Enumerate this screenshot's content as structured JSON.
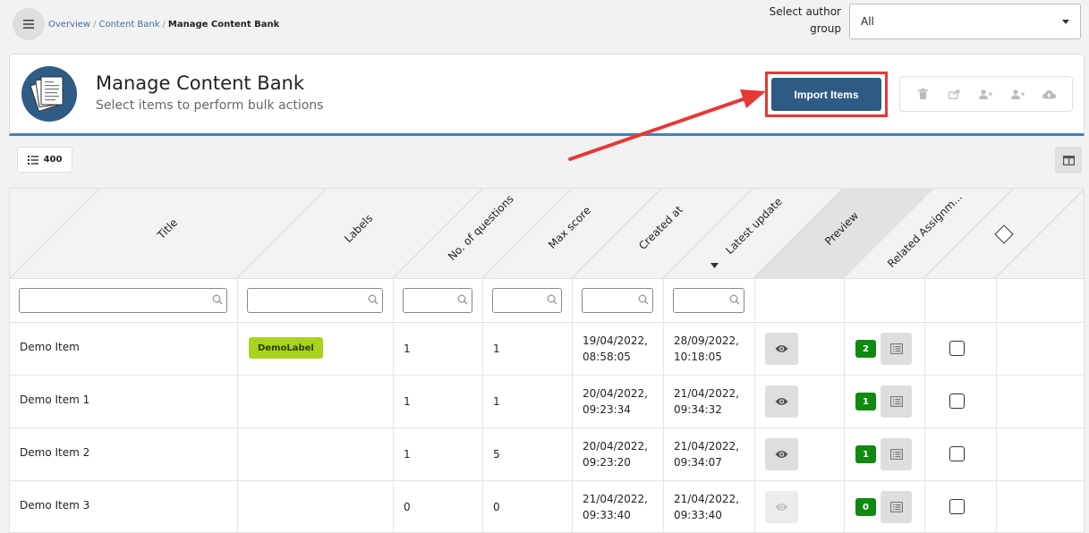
{
  "breadcrumb": {
    "items": [
      "Overview",
      "Content Bank"
    ],
    "separator": "/",
    "current": "Manage Content Bank"
  },
  "author_group": {
    "label": "Select author group",
    "value": "All"
  },
  "header": {
    "title": "Manage Content Bank",
    "subtitle": "Select items to perform bulk actions",
    "import_label": "Import Items",
    "actions": [
      "trash-icon",
      "share-icon",
      "add-user-icon",
      "add-user-icon",
      "cloud-upload-icon"
    ]
  },
  "toolbar": {
    "count": "400"
  },
  "table": {
    "columns": [
      "Title",
      "Labels",
      "No. of questions",
      "Max score",
      "Created at",
      "Latest update",
      "Preview",
      "Related Assignm..."
    ],
    "sorted_column": "Latest update",
    "rows": [
      {
        "title": "Demo Item",
        "label": "DemoLabel",
        "questions": "1",
        "max_score": "1",
        "created_date": "19/04/2022,",
        "created_time": "08:58:05",
        "updated_date": "28/09/2022,",
        "updated_time": "10:18:05",
        "preview_enabled": true,
        "assignments": "2"
      },
      {
        "title": "Demo Item 1",
        "label": "",
        "questions": "1",
        "max_score": "1",
        "created_date": "20/04/2022,",
        "created_time": "09:23:34",
        "updated_date": "21/04/2022,",
        "updated_time": "09:34:32",
        "preview_enabled": true,
        "assignments": "1"
      },
      {
        "title": "Demo Item 2",
        "label": "",
        "questions": "1",
        "max_score": "5",
        "created_date": "20/04/2022,",
        "created_time": "09:23:20",
        "updated_date": "21/04/2022,",
        "updated_time": "09:34:07",
        "preview_enabled": true,
        "assignments": "1"
      },
      {
        "title": "Demo Item 3",
        "label": "",
        "questions": "0",
        "max_score": "0",
        "created_date": "21/04/2022,",
        "created_time": "09:33:40",
        "updated_date": "21/04/2022,",
        "updated_time": "09:33:40",
        "preview_enabled": false,
        "assignments": "0"
      }
    ]
  },
  "colors": {
    "primary": "#2e5a84",
    "accent_border": "#3e82c0",
    "highlight": "#e53935",
    "label_badge": "#a8d41e",
    "count_badge": "#0f8a0f"
  }
}
